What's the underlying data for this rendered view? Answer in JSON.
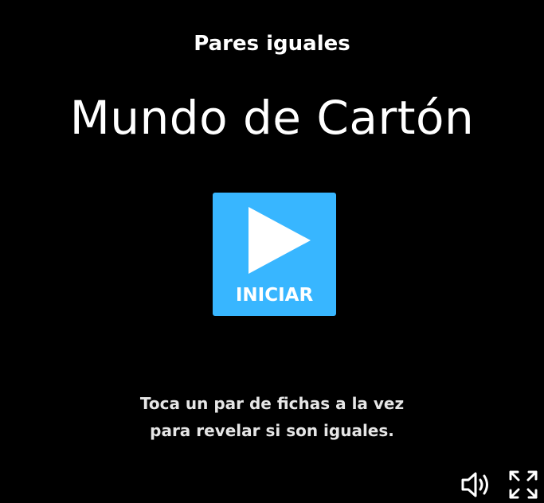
{
  "game": {
    "subtitle": "Pares iguales",
    "title": "Mundo de Cartón",
    "start_label": "INICIAR",
    "instructions": [
      "Toca un par de fichas a la vez",
      "para revelar si son iguales."
    ]
  },
  "controls": {
    "sound_icon": "speaker-volume-icon",
    "fullscreen_icon": "fullscreen-expand-icon"
  },
  "colors": {
    "background": "#000000",
    "accent": "#38b6ff",
    "text": "#ffffff"
  }
}
